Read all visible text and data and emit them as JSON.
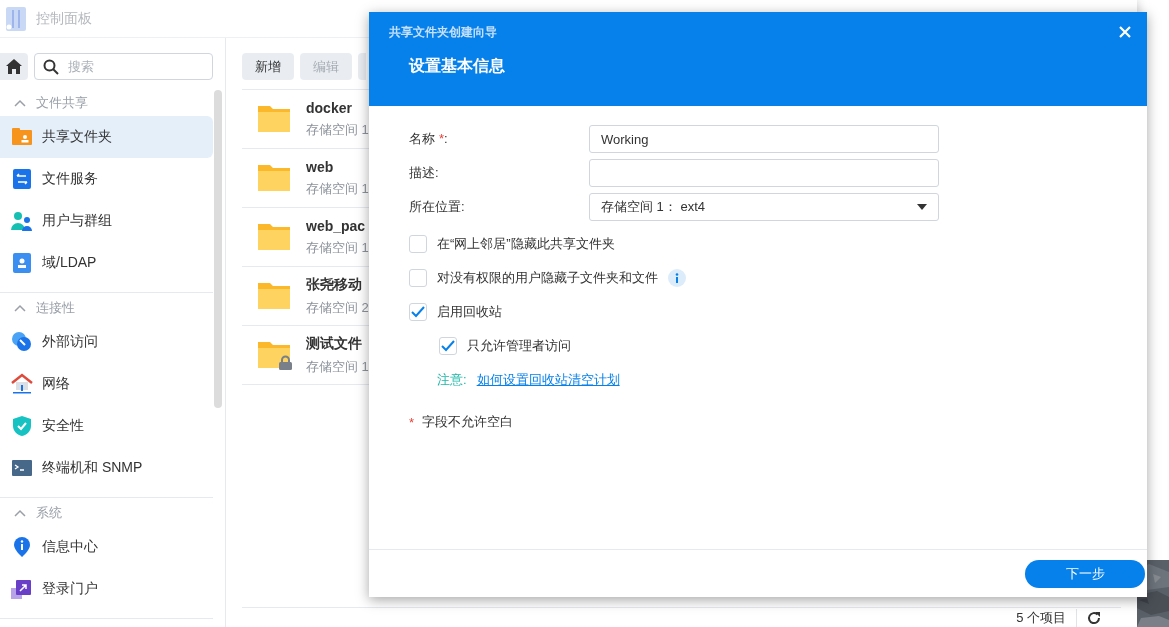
{
  "window": {
    "title": "控制面板"
  },
  "sidebar": {
    "search_placeholder": "搜索",
    "sections": [
      {
        "title": "文件共享",
        "expanded": true,
        "items": [
          {
            "label": "共享文件夹",
            "selected": true
          },
          {
            "label": "文件服务",
            "selected": false
          },
          {
            "label": "用户与群组",
            "selected": false
          },
          {
            "label": "域/LDAP",
            "selected": false
          }
        ]
      },
      {
        "title": "连接性",
        "expanded": true,
        "items": [
          {
            "label": "外部访问",
            "selected": false
          },
          {
            "label": "网络",
            "selected": false
          },
          {
            "label": "安全性",
            "selected": false
          },
          {
            "label": "终端机和 SNMP",
            "selected": false
          }
        ]
      },
      {
        "title": "系统",
        "expanded": true,
        "items": [
          {
            "label": "信息中心",
            "selected": false
          },
          {
            "label": "登录门户",
            "selected": false
          }
        ]
      }
    ]
  },
  "toolbar": {
    "buttons": [
      {
        "label": "新增",
        "disabled": false
      },
      {
        "label": "编辑",
        "disabled": true
      }
    ]
  },
  "folders": [
    {
      "name": "docker",
      "location": "存储空间 1",
      "locked": false
    },
    {
      "name": "web",
      "location": "存储空间 1",
      "locked": false
    },
    {
      "name": "web_pac",
      "location": "存储空间 1",
      "locked": false
    },
    {
      "name": "张尧移动",
      "location": "存储空间 2",
      "locked": false
    },
    {
      "name": "测试文件",
      "location": "存储空间 1",
      "locked": true
    }
  ],
  "status_bar": {
    "count": "5 个项目"
  },
  "dialog": {
    "title": "共享文件夹创建向导",
    "heading": "设置基本信息",
    "fields": [
      {
        "kind": "text",
        "label": "名称",
        "mark": "*",
        "suffix": ":",
        "value": "Working"
      },
      {
        "kind": "text",
        "label": "描述:"
      },
      {
        "kind": "select",
        "label": "所在位置:",
        "value": "存储空间 1： ext4"
      }
    ],
    "options": [
      {
        "label": "在“网上邻居”隐藏此共享文件夹",
        "checked": false,
        "info": false
      },
      {
        "label": "对没有权限的用户隐藏子文件夹和文件",
        "checked": false,
        "info": true
      },
      {
        "label": "启用回收站",
        "checked": true,
        "info": false,
        "children": [
          {
            "label": "只允许管理者访问",
            "checked": true,
            "info": false
          }
        ]
      }
    ],
    "note": {
      "label": "注意:",
      "link": "如何设置回收站清空计划"
    },
    "required_note": {
      "mark": "*",
      "text": "字段不允许空白"
    },
    "next_button": "下一步"
  }
}
